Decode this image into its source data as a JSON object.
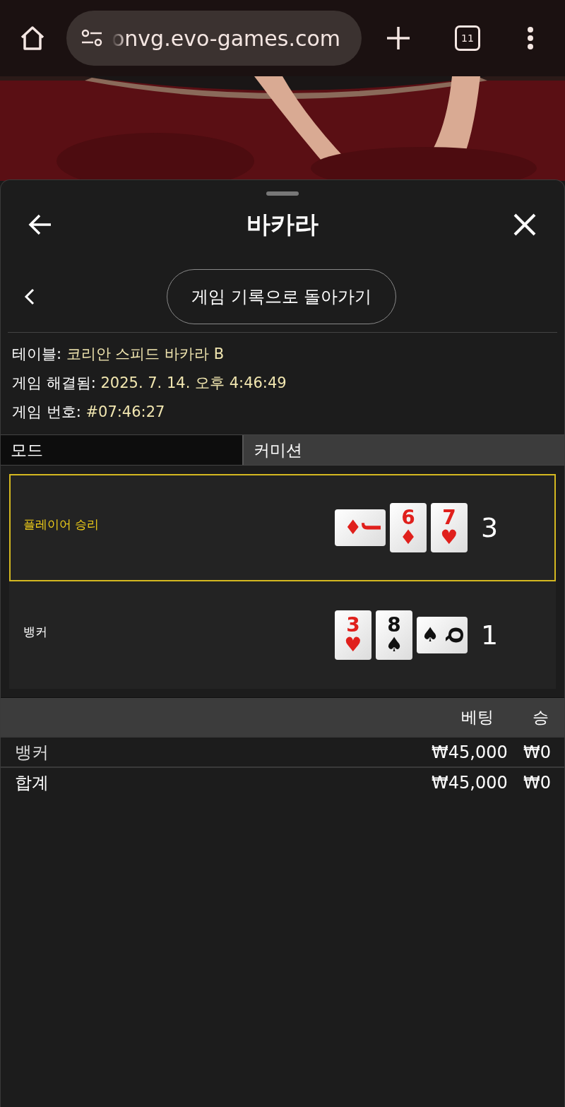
{
  "browser": {
    "url": "onvg.evo-games.com",
    "tab_count": "11"
  },
  "sheet": {
    "title": "바카라",
    "back_link": "게임 기록으로 돌아가기",
    "info": [
      {
        "label": "테이블:",
        "value": "코리안 스피드 바카라 B"
      },
      {
        "label": "게임 해결됨:",
        "value": "2025. 7. 14. 오후 4:46:49"
      },
      {
        "label": "게임 번호:",
        "value": "#07:46:27"
      }
    ],
    "mode_table": {
      "columns": [
        "모드",
        "커미션"
      ]
    },
    "hands": [
      {
        "label": "플레이어 승리",
        "winner": true,
        "total": "3",
        "cards": [
          {
            "rank": "J",
            "suit": "♦",
            "color": "#e0201c",
            "sideways": true
          },
          {
            "rank": "6",
            "suit": "♦",
            "color": "#e0201c",
            "sideways": false
          },
          {
            "rank": "7",
            "suit": "♥",
            "color": "#e0201c",
            "sideways": false
          }
        ]
      },
      {
        "label": "뱅커",
        "winner": false,
        "total": "1",
        "cards": [
          {
            "rank": "3",
            "suit": "♥",
            "color": "#e0201c",
            "sideways": false
          },
          {
            "rank": "8",
            "suit": "♠",
            "color": "#111111",
            "sideways": false
          },
          {
            "rank": "Q",
            "suit": "♠",
            "color": "#111111",
            "sideways": true
          }
        ]
      }
    ],
    "bets": {
      "columns": [
        "베팅",
        "승"
      ],
      "rows": [
        {
          "kind": "bet",
          "name": "뱅커",
          "bet": "₩45,000",
          "win": "₩0"
        },
        {
          "kind": "total",
          "name": "합계",
          "bet": "₩45,000",
          "win": "₩0"
        }
      ]
    }
  }
}
